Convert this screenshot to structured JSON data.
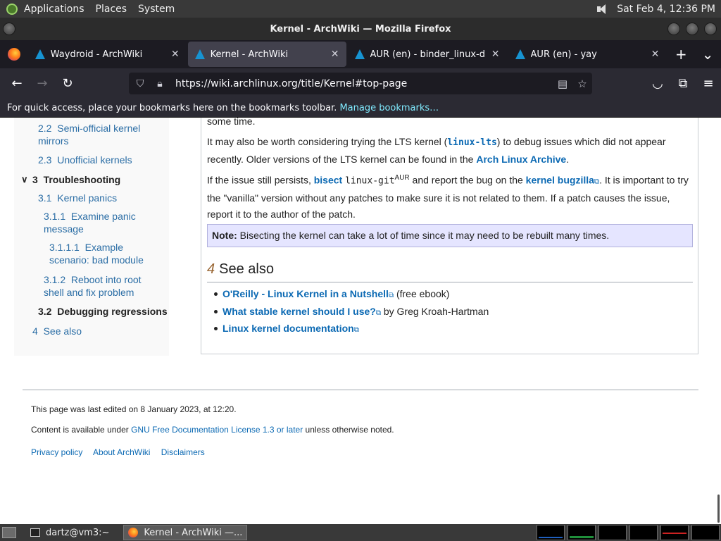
{
  "top_panel": {
    "menus": [
      "Applications",
      "Places",
      "System"
    ],
    "clock": "Sat Feb  4, 12:36 PM"
  },
  "window": {
    "title": "Kernel - ArchWiki — Mozilla Firefox"
  },
  "tabs": [
    {
      "label": "Waydroid - ArchWiki"
    },
    {
      "label": "Kernel - ArchWiki"
    },
    {
      "label": "AUR (en) - binder_linux-dkms"
    },
    {
      "label": "AUR (en) - yay"
    }
  ],
  "urlbar": {
    "url": "https://wiki.archlinux.org/title/Kernel#top-page"
  },
  "bookmarks_bar": {
    "text": "For quick access, place your bookmarks here on the bookmarks toolbar.",
    "link": "Manage bookmarks…"
  },
  "toc": {
    "item_2_2_num": "2.2",
    "item_2_2_a": "Semi-official kernel",
    "item_2_2_b": "mirrors",
    "item_2_3_num": "2.3",
    "item_2_3": "Unofficial kernels",
    "item_3_num": "3",
    "item_3": "Troubleshooting",
    "item_3_1_num": "3.1",
    "item_3_1": "Kernel panics",
    "item_3_1_1_num": "3.1.1",
    "item_3_1_1_a": "Examine panic",
    "item_3_1_1_b": "message",
    "item_3_1_1_1_num": "3.1.1.1",
    "item_3_1_1_1_a": "Example",
    "item_3_1_1_1_b": "scenario: bad module",
    "item_3_1_2_num": "3.1.2",
    "item_3_1_2_a": "Reboot into root",
    "item_3_1_2_b": "shell and fix problem",
    "item_3_2_num": "3.2",
    "item_3_2": "Debugging regressions",
    "item_4_num": "4",
    "item_4": "See also"
  },
  "article": {
    "p0": "some time.",
    "p1_a": "It may also be worth considering trying the LTS kernel (",
    "p1_code": "linux-lts",
    "p1_b": ") to debug issues which did not appear recently. Older versions of the LTS kernel can be found in the ",
    "p1_link": "Arch Linux Archive",
    "p1_c": ".",
    "p2_a": "If the issue still persists, ",
    "p2_bisect": "bisect",
    "p2_code": "linux-git",
    "p2_sup": "AUR",
    "p2_b": " and report the bug on the ",
    "p2_link": "kernel bugzilla",
    "p2_c": ". It is important to try the \"vanilla\" version without any patches to make sure it is not related to them. If a patch causes the issue, report it to the author of the patch.",
    "note_label": "Note:",
    "note_text": " Bisecting the kernel can take a lot of time since it may need to be rebuilt many times.",
    "see_also_num": "4",
    "see_also_title": "See also",
    "see_also": [
      {
        "link": "O'Reilly - Linux Kernel in a Nutshell",
        "suffix": " (free ebook)"
      },
      {
        "link": "What stable kernel should I use?",
        "suffix": " by Greg Kroah-Hartman"
      },
      {
        "link": "Linux kernel documentation",
        "suffix": ""
      }
    ]
  },
  "footer": {
    "last_edited": "This page was last edited on 8 January 2023, at 12:20.",
    "license_a": "Content is available under ",
    "license_link": "GNU Free Documentation License 1.3 or later",
    "license_b": " unless otherwise noted.",
    "links": [
      "Privacy policy",
      "About ArchWiki",
      "Disclaimers"
    ]
  },
  "taskbar": {
    "items": [
      {
        "label": "dartz@vm3:~"
      },
      {
        "label": "Kernel - ArchWiki —..."
      }
    ]
  },
  "colors": {
    "link": "#0b69b3",
    "note_bg": "#e5e5ff",
    "heading_number": "#996633",
    "tab_active": "#42414d"
  }
}
